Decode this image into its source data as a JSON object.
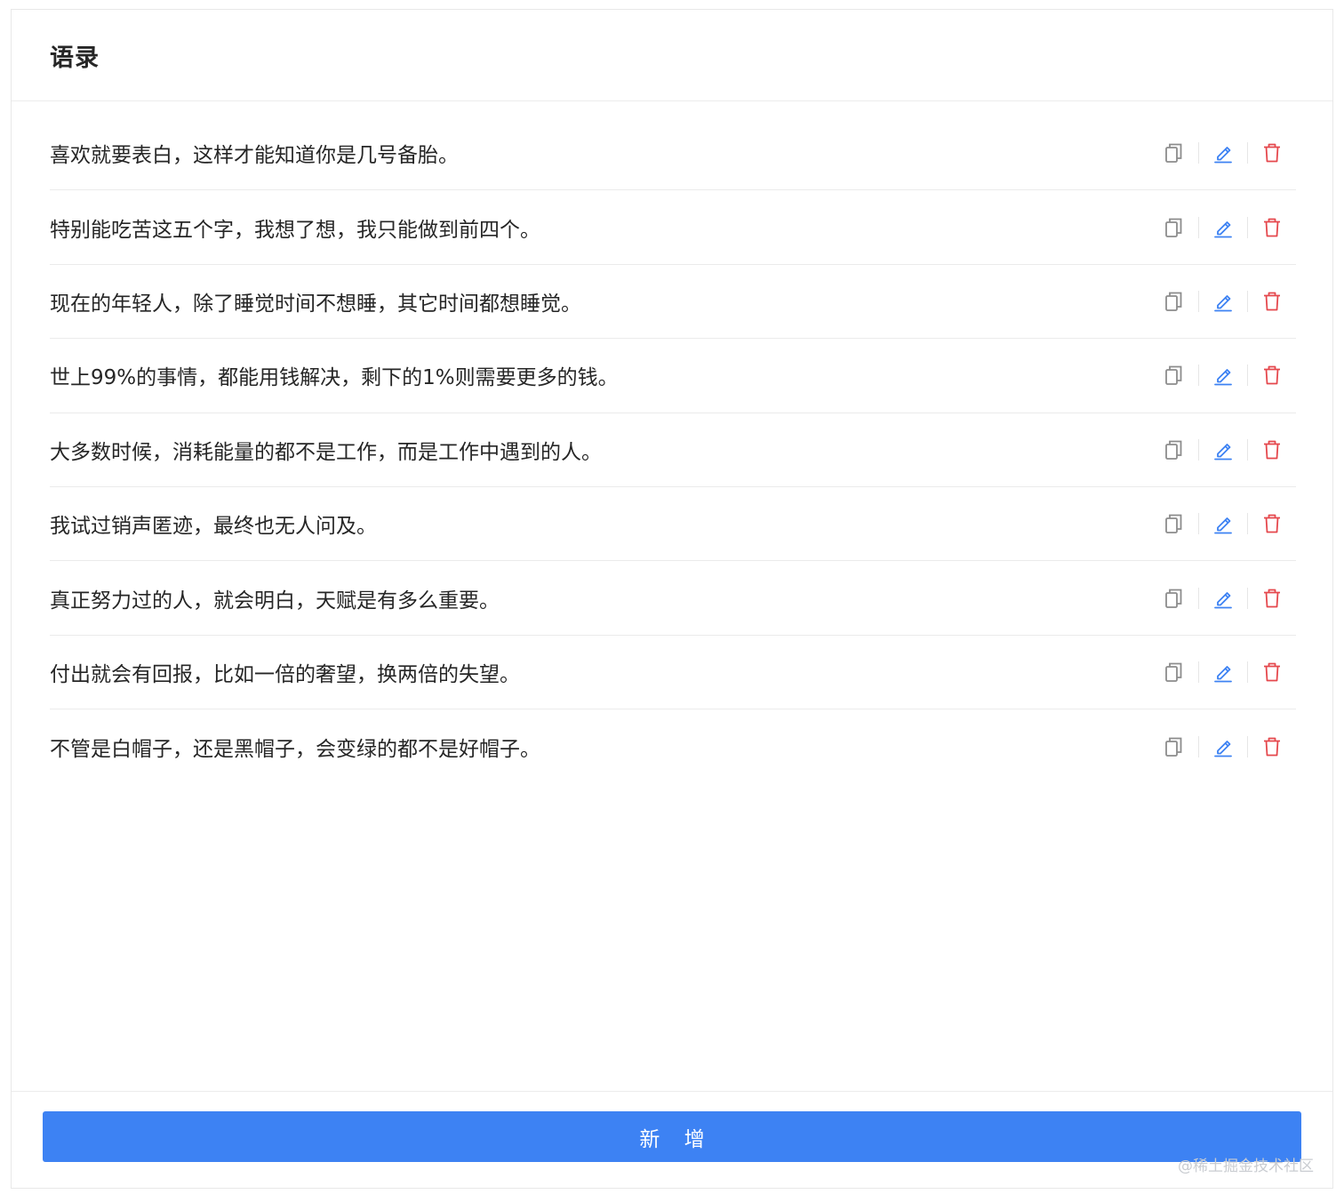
{
  "header": {
    "title": "语录"
  },
  "quotes": [
    "喜欢就要表白，这样才能知道你是几号备胎。",
    "特别能吃苦这五个字，我想了想，我只能做到前四个。",
    "现在的年轻人，除了睡觉时间不想睡，其它时间都想睡觉。",
    "世上99%的事情，都能用钱解决，剩下的1%则需要更多的钱。",
    "大多数时候，消耗能量的都不是工作，而是工作中遇到的人。",
    "我试过销声匿迹，最终也无人问及。",
    "真正努力过的人，就会明白，天赋是有多么重要。",
    "付出就会有回报，比如一倍的奢望，换两倍的失望。",
    "不管是白帽子，还是黑帽子，会变绿的都不是好帽子。"
  ],
  "row_actions": {
    "copy_icon": "copy-icon",
    "edit_icon": "edit-icon",
    "delete_icon": "delete-icon"
  },
  "footer": {
    "add_label": "新 增"
  },
  "watermark": "@稀土掘金技术社区",
  "colors": {
    "primary": "#3d82f3",
    "danger": "#e5484d",
    "icon_gray": "#8c8c8c"
  }
}
